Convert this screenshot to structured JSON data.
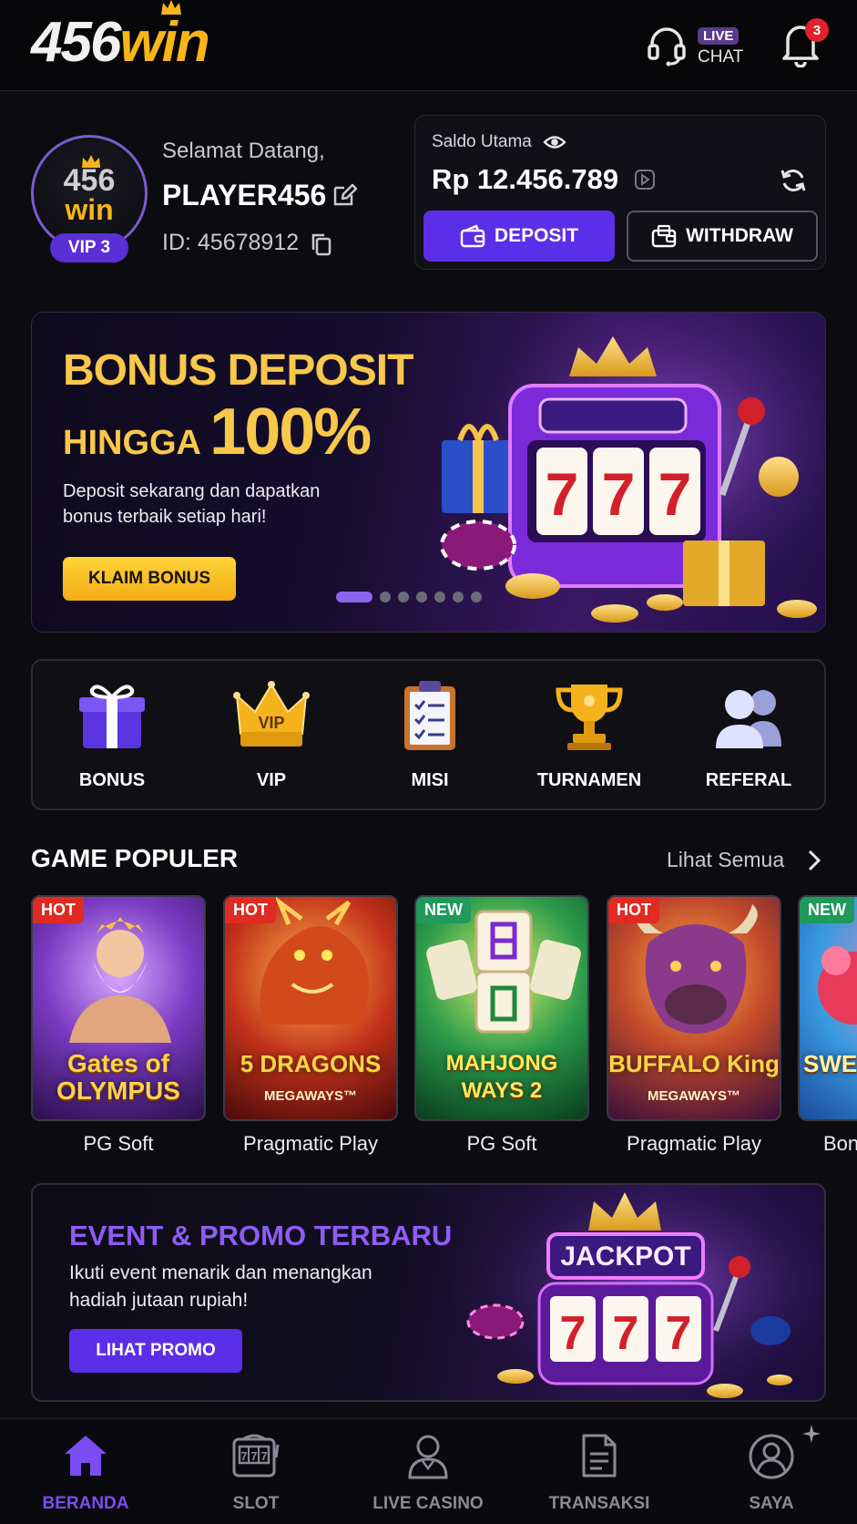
{
  "header": {
    "logo_num": "456",
    "logo_win": "win",
    "live_badge": "LIVE",
    "chat_label": "CHAT",
    "notification_count": "3"
  },
  "profile": {
    "avatar_num": "456",
    "avatar_win": "win",
    "vip_level": "VIP 3",
    "welcome": "Selamat Datang,",
    "username": "PLAYER456",
    "player_id": "ID: 45678912"
  },
  "balance": {
    "label": "Saldo Utama",
    "value": "Rp 12.456.789",
    "deposit_label": "DEPOSIT",
    "withdraw_label": "WITHDRAW"
  },
  "banner": {
    "title_line1": "BONUS DEPOSIT",
    "title_line2_small": "HINGGA ",
    "title_line2_big": "100%",
    "description": "Deposit sekarang dan dapatkan bonus terbaik setiap hari!",
    "cta": "KLAIM BONUS",
    "slot_digits": [
      "7",
      "7",
      "7"
    ]
  },
  "quick_menu": [
    {
      "label": "BONUS",
      "icon": "gift-icon"
    },
    {
      "label": "VIP",
      "icon": "crown-icon"
    },
    {
      "label": "MISI",
      "icon": "clipboard-icon"
    },
    {
      "label": "TURNAMEN",
      "icon": "trophy-icon"
    },
    {
      "label": "REFERAL",
      "icon": "users-icon"
    }
  ],
  "games_section": {
    "title": "GAME POPULER",
    "see_all": "Lihat Semua"
  },
  "games": [
    {
      "tag": "HOT",
      "title": "Gates of OLYMPUS",
      "subtitle": "",
      "provider": "PG Soft",
      "color": "#6a3aa8"
    },
    {
      "tag": "HOT",
      "title": "5 DRAGONS",
      "subtitle": "MEGAWAYS™",
      "provider": "Pragmatic Play",
      "color": "#b4301a"
    },
    {
      "tag": "NEW",
      "title": "MAHJONG WAYS 2",
      "subtitle": "",
      "provider": "PG Soft",
      "color": "#1f7a3e"
    },
    {
      "tag": "HOT",
      "title": "BUFFALO King",
      "subtitle": "MEGAWAYS™",
      "provider": "Pragmatic Play",
      "color": "#8a2a6a"
    },
    {
      "tag": "NEW",
      "title": "SWEE SWEE",
      "subtitle": "",
      "provider": "Bon",
      "color": "#2a7ad0"
    }
  ],
  "promo": {
    "title": "EVENT & PROMO TERBARU",
    "description": "Ikuti event menarik dan menangkan hadiah jutaan rupiah!",
    "cta": "LIHAT PROMO",
    "jackpot_label": "JACKPOT",
    "slot_digits": [
      "7",
      "7",
      "7"
    ]
  },
  "bottom_nav": [
    {
      "label": "BERANDA",
      "icon": "home-icon",
      "active": true
    },
    {
      "label": "SLOT",
      "icon": "slot-machine-icon",
      "active": false
    },
    {
      "label": "LIVE CASINO",
      "icon": "dealer-icon",
      "active": false
    },
    {
      "label": "TRANSAKSI",
      "icon": "document-icon",
      "active": false
    },
    {
      "label": "SAYA",
      "icon": "profile-icon",
      "active": false
    }
  ],
  "colors": {
    "accent": "#5b2ee8",
    "gold": "#f7b518",
    "hot": "#e02a22",
    "new": "#1f9a5a"
  }
}
